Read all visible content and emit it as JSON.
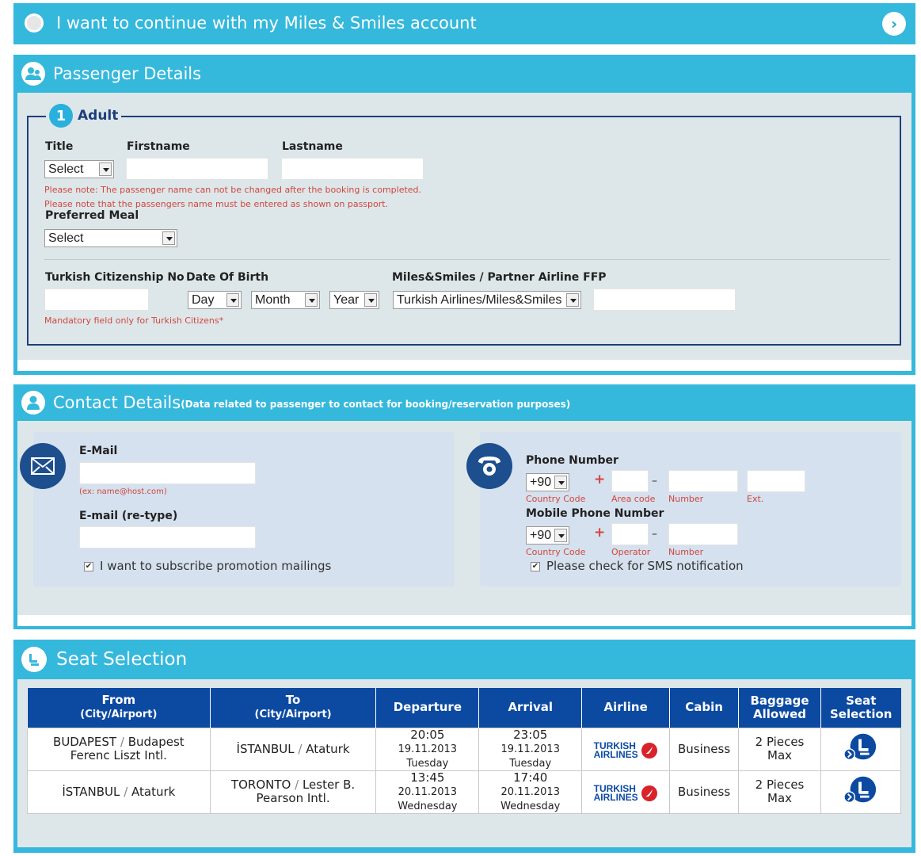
{
  "miles": {
    "label": "I want to continue with my Miles & Smiles account"
  },
  "passenger": {
    "title": "Passenger Details",
    "adult_number": "1",
    "adult_label": "Adult",
    "labels": {
      "title": "Title",
      "firstname": "Firstname",
      "lastname": "Lastname",
      "meal": "Preferred Meal",
      "citizenship": "Turkish Citizenship No",
      "dob": "Date Of Birth",
      "ffp": "Miles&Smiles / Partner Airline FFP"
    },
    "selects": {
      "title": "Select",
      "meal": "Select",
      "day": "Day",
      "month": "Month",
      "year": "Year",
      "ffp": "Turkish Airlines/Miles&Smiles"
    },
    "notes": {
      "name_change": "Please note: The passenger name can not be changed after the booking is completed.",
      "passport": "Please note that the passengers name must be entered as shown on passport.",
      "citizen": "Mandatory field only for Turkish Citizens*"
    }
  },
  "contact": {
    "title": "Contact Details",
    "subtitle": "(Data related to passenger to contact for booking/reservation purposes)",
    "email_label": "E-Mail",
    "email_hint": "(ex: name@host.com)",
    "email_retype_label": "E-mail (re-type)",
    "subscribe_label": "I want to subscribe promotion mailings",
    "phone_label": "Phone Number",
    "country_code": "+90",
    "phone_sub": {
      "country": "Country Code",
      "area": "Area code",
      "number": "Number",
      "ext": "Ext."
    },
    "mobile_label": "Mobile Phone Number",
    "mobile_country_code": "+90",
    "mobile_sub": {
      "country": "Country Code",
      "operator": "Operator",
      "number": "Number"
    },
    "sms_label": "Please check for SMS notification",
    "check_mark": "✔",
    "plus": "+",
    "dash": "–"
  },
  "seat": {
    "title": "Seat Selection",
    "headers": {
      "from": "From",
      "from_sub": "(City/Airport)",
      "to": "To",
      "to_sub": "(City/Airport)",
      "departure": "Departure",
      "arrival": "Arrival",
      "airline": "Airline",
      "cabin": "Cabin",
      "baggage1": "Baggage",
      "baggage2": "Allowed",
      "seat1": "Seat",
      "seat2": "Selection"
    },
    "slash": "/",
    "rows": [
      {
        "from_city": "BUDAPEST",
        "from_airport": "Budapest",
        "from_airport2": "Ferenc Liszt Intl.",
        "to_city": "İSTANBUL",
        "to_airport": "Ataturk",
        "to_airport2": "",
        "dep_time": "20:05",
        "dep_date": "19.11.2013",
        "dep_day": "Tuesday",
        "arr_time": "23:05",
        "arr_date": "19.11.2013",
        "arr_day": "Tuesday",
        "airline1": "TURKISH",
        "airline2": "AIRLINES",
        "cabin": "Business",
        "baggage1": "2 Pieces",
        "baggage2": "Max"
      },
      {
        "from_city": "İSTANBUL",
        "from_airport": "Ataturk",
        "from_airport2": "",
        "to_city": "TORONTO",
        "to_airport": "Lester B.",
        "to_airport2": "Pearson Intl.",
        "dep_time": "13:45",
        "dep_date": "20.11.2013",
        "dep_day": "Wednesday",
        "arr_time": "17:40",
        "arr_date": "20.11.2013",
        "arr_day": "Wednesday",
        "airline1": "TURKISH",
        "airline2": "AIRLINES",
        "cabin": "Business",
        "baggage1": "2 Pieces",
        "baggage2": "Max"
      }
    ]
  }
}
